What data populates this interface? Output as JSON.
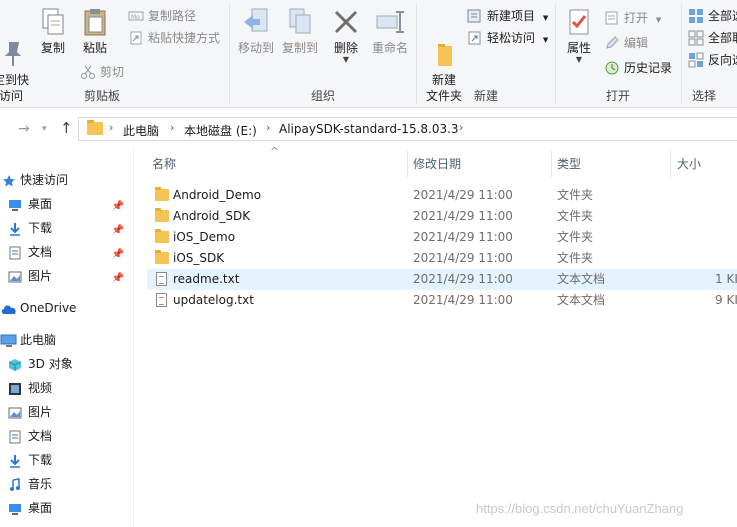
{
  "ribbon": {
    "clipboard": {
      "pin_quick_access": "定到快\n访问",
      "copy": "复制",
      "paste": "粘贴",
      "copy_path": "复制路径",
      "paste_shortcut": "粘贴快捷方式",
      "cut": "剪切",
      "group_label": "剪贴板"
    },
    "organize": {
      "move_to": "移动到",
      "copy_to": "复制到",
      "delete": "删除",
      "rename": "重命名",
      "group_label": "组织"
    },
    "new": {
      "new_folder": "新建\n文件夹",
      "new_item": "新建项目",
      "easy_access": "轻松访问",
      "group_label": "新建"
    },
    "open": {
      "properties": "属性",
      "open": "打开",
      "edit": "编辑",
      "history": "历史记录",
      "group_label": "打开"
    },
    "select": {
      "select_all": "全部选",
      "select_none": "全部取",
      "invert": "反向选",
      "group_label": "选择"
    }
  },
  "address": {
    "crumbs": [
      "此电脑",
      "本地磁盘 (E:)",
      "AlipaySDK-standard-15.8.03.3"
    ]
  },
  "nav_pane": {
    "quick_access": "快速访问",
    "quick_items": [
      "桌面",
      "下载",
      "文档",
      "图片"
    ],
    "onedrive": "OneDrive",
    "this_pc": "此电脑",
    "pc_items": [
      "3D 对象",
      "视频",
      "图片",
      "文档",
      "下载",
      "音乐",
      "桌面"
    ]
  },
  "columns": {
    "name": "名称",
    "date": "修改日期",
    "type": "类型",
    "size": "大小"
  },
  "files": [
    {
      "name": "Android_Demo",
      "date": "2021/4/29 11:00",
      "type": "文件夹",
      "size": "",
      "kind": "folder"
    },
    {
      "name": "Android_SDK",
      "date": "2021/4/29 11:00",
      "type": "文件夹",
      "size": "",
      "kind": "folder"
    },
    {
      "name": "iOS_Demo",
      "date": "2021/4/29 11:00",
      "type": "文件夹",
      "size": "",
      "kind": "folder"
    },
    {
      "name": "iOS_SDK",
      "date": "2021/4/29 11:00",
      "type": "文件夹",
      "size": "",
      "kind": "folder"
    },
    {
      "name": "readme.txt",
      "date": "2021/4/29 11:00",
      "type": "文本文档",
      "size": "1 KI",
      "kind": "txt",
      "selected": true
    },
    {
      "name": "updatelog.txt",
      "date": "2021/4/29 11:00",
      "type": "文本文档",
      "size": "9 KI",
      "kind": "txt"
    }
  ],
  "watermark": "https://blog.csdn.net/chuYuanZhang"
}
